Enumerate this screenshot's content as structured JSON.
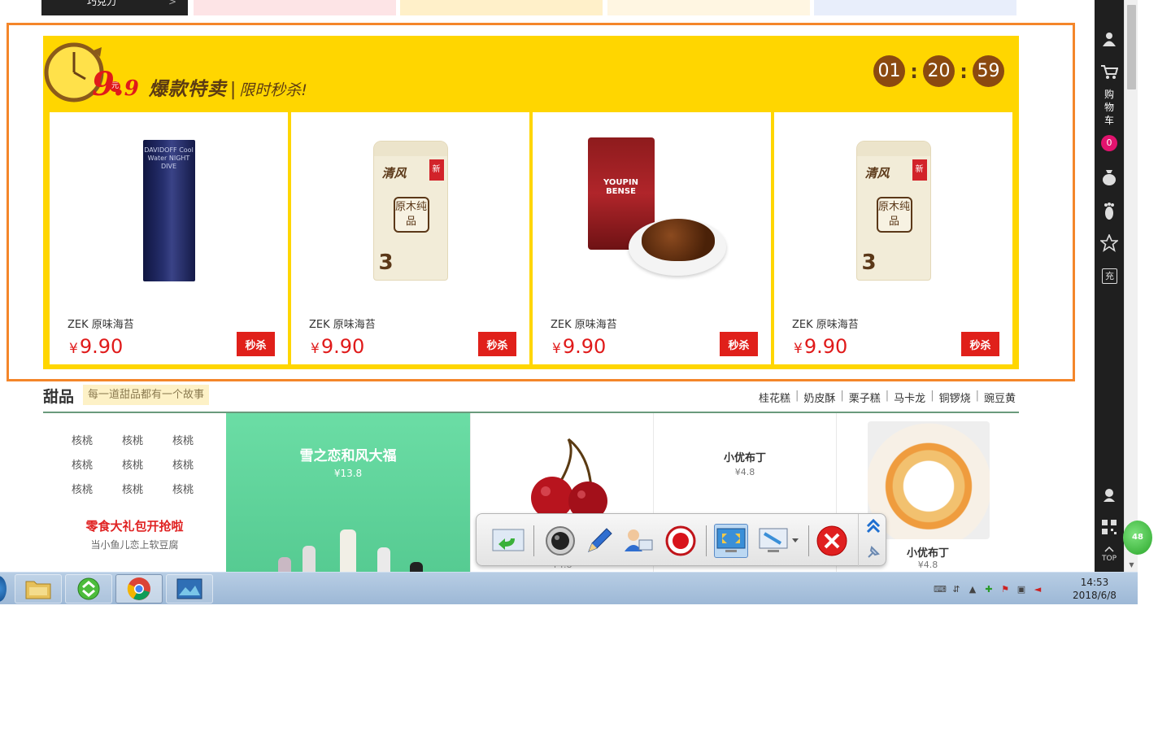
{
  "top_banner": {
    "dark_label": "巧克力",
    "dark_arrow": ">"
  },
  "flash": {
    "brand_99": "9.",
    "brand_99b": "9",
    "brand_yuan": "元",
    "title": "爆款特卖",
    "separator": "|",
    "subtitle": "限时秒杀!",
    "timer": {
      "hours": "01",
      "minutes": "20",
      "seconds": "59",
      "colon": ":"
    },
    "products": [
      {
        "name": "ZEK 原味海苔",
        "currency": "¥",
        "price": "9.90",
        "button": "秒杀"
      },
      {
        "name": "ZEK 原味海苔",
        "currency": "¥",
        "price": "9.90",
        "button": "秒杀"
      },
      {
        "name": "ZEK 原味海苔",
        "currency": "¥",
        "price": "9.90",
        "button": "秒杀"
      },
      {
        "name": "ZEK 原味海苔",
        "currency": "¥",
        "price": "9.90",
        "button": "秒杀"
      }
    ],
    "product_art": {
      "perfume_text": "DAVIDOFF Cool Water NIGHT DIVE",
      "tissue_logo": "清风",
      "tissue_new": "新",
      "tissue_box": "原木纯品",
      "tissue_count": "3",
      "raisin_brand": "YOUPIN BENSE"
    }
  },
  "dessert": {
    "title": "甜品",
    "slogan": "每一道甜品都有一个故事",
    "links": [
      "桂花糕",
      "奶皮酥",
      "栗子糕",
      "马卡龙",
      "铜锣烧",
      "豌豆黄"
    ],
    "link_sep": "|",
    "walnuts": [
      "核桃",
      "核桃",
      "核桃",
      "核桃",
      "核桃",
      "核桃",
      "核桃",
      "核桃",
      "核桃"
    ],
    "promo_title": "零食大礼包开抢啦",
    "promo_sub": "当小鱼儿恋上软豆腐",
    "green_title": "雪之恋和风大福",
    "green_price": "¥13.8",
    "cherry_price": "¥4.8",
    "pudding1_title": "小优布丁",
    "pudding1_price": "¥4.8",
    "pudding2_title": "小优布丁",
    "pudding2_price": "¥4.8"
  },
  "sidebar": {
    "cart_text": "购\n物\n车",
    "cart_count": "0",
    "recharge": "充",
    "top_label": "TOP"
  },
  "green_ball": "48",
  "taskbar": {
    "time": "14:53",
    "date": "2018/6/8"
  }
}
